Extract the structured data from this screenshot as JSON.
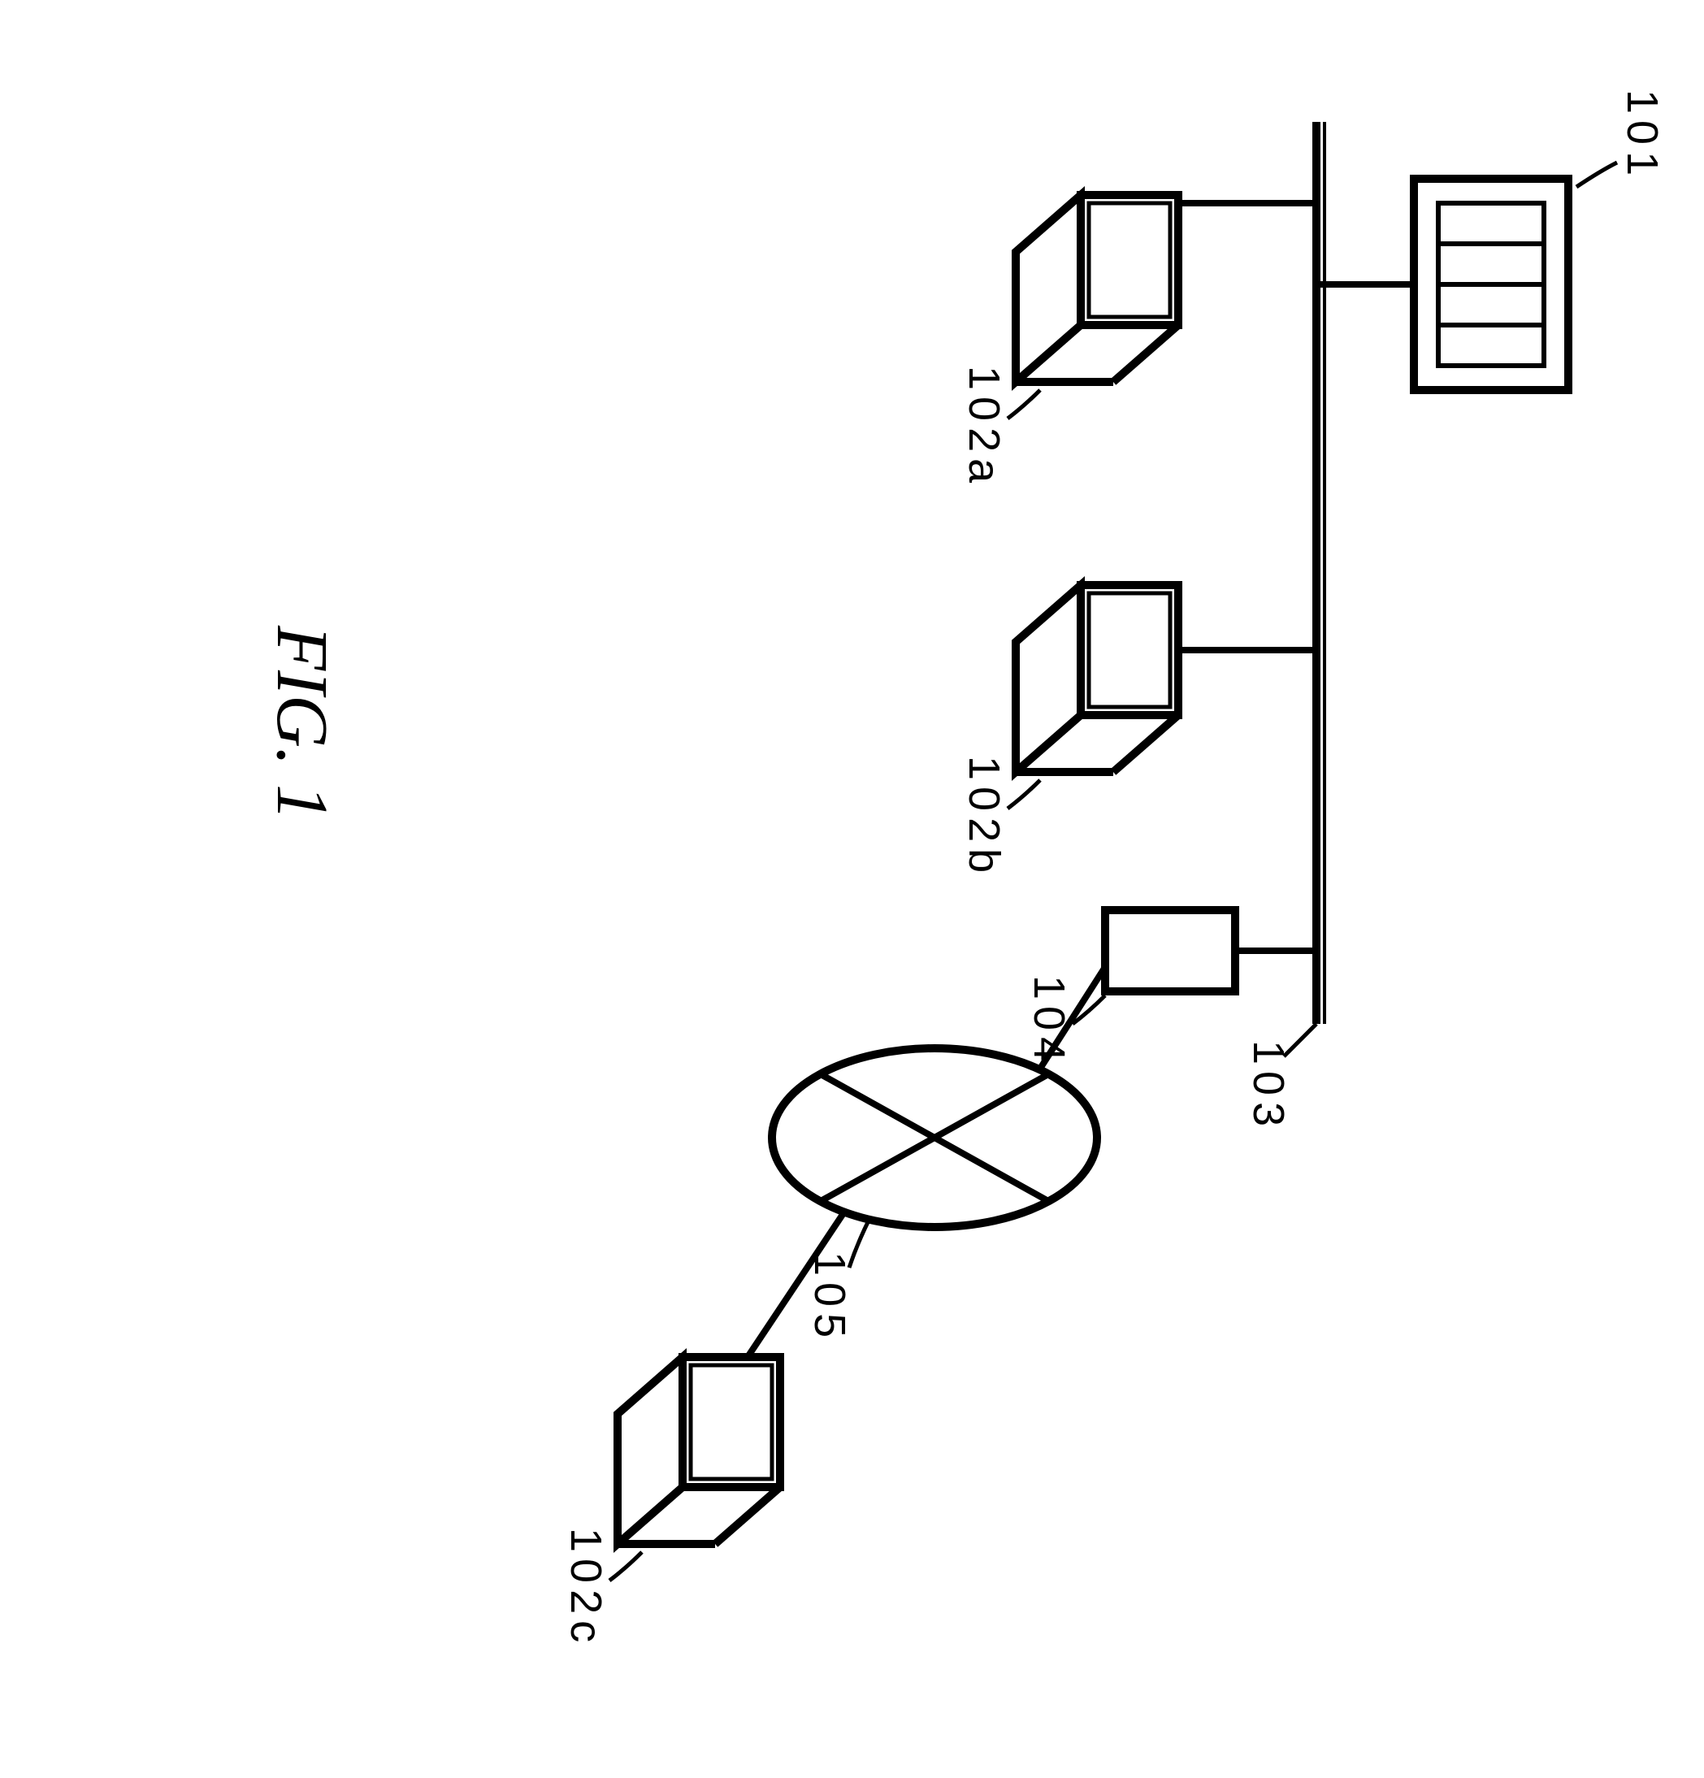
{
  "figure_caption": "FIG. 1",
  "labels": {
    "server": "101",
    "client_a": "102a",
    "client_b": "102b",
    "client_c": "102c",
    "bus_line": "103",
    "router": "104",
    "network_cloud": "105"
  },
  "diagram": {
    "type": "network-topology",
    "description": "Patent figure showing network diagram with server, clients, bus line, router/gateway, and network cloud"
  }
}
